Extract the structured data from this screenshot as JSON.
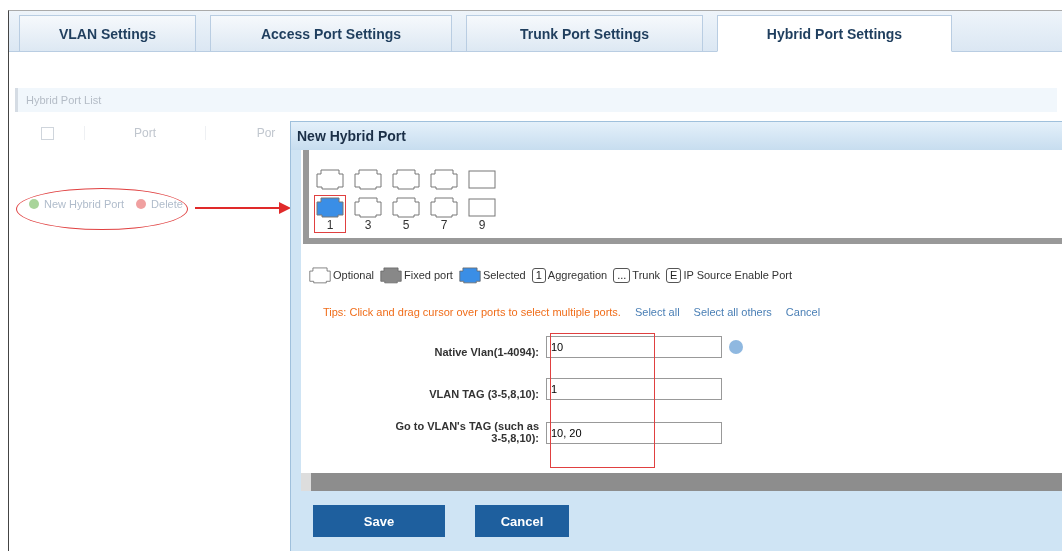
{
  "tabs": [
    {
      "label": "VLAN Settings",
      "selected": false
    },
    {
      "label": "Access Port Settings",
      "selected": false
    },
    {
      "label": "Trunk Port Settings",
      "selected": false
    },
    {
      "label": "Hybrid Port Settings",
      "selected": true
    }
  ],
  "panel": {
    "title": "Hybrid Port List",
    "columns": [
      "Port",
      "Por"
    ],
    "select_all": {
      "checked": false
    },
    "actions": [
      {
        "kind": "add",
        "label": "New Hybrid Port"
      },
      {
        "kind": "delete",
        "label": "Delete"
      }
    ]
  },
  "dialog": {
    "title": "New Hybrid Port",
    "port_rows": [
      [
        {
          "kind": "copper",
          "selected": false
        },
        {
          "kind": "copper",
          "selected": false
        },
        {
          "kind": "copper",
          "selected": false
        },
        {
          "kind": "copper",
          "selected": false
        },
        {
          "kind": "fiber",
          "selected": false
        }
      ],
      [
        {
          "kind": "copper",
          "label": "1",
          "selected": true
        },
        {
          "kind": "copper",
          "label": "3",
          "selected": false
        },
        {
          "kind": "copper",
          "label": "5",
          "selected": false
        },
        {
          "kind": "copper",
          "label": "7",
          "selected": false
        },
        {
          "kind": "fiber",
          "label": "9",
          "selected": false
        }
      ]
    ],
    "legend": [
      {
        "kind": "optional",
        "label": "Optional"
      },
      {
        "kind": "fixed",
        "label": "Fixed port"
      },
      {
        "kind": "selected",
        "label": "Selected"
      },
      {
        "kind": "boxed",
        "icon_text": "1",
        "label": "Aggregation"
      },
      {
        "kind": "trunk",
        "icon_text": "...",
        "label": "Trunk"
      },
      {
        "kind": "boxed",
        "icon_text": "E",
        "label": "IP Source Enable Port"
      }
    ],
    "tip": "Tips: Click and drag cursor over ports to select multiple ports.",
    "links": [
      "Select all",
      "Select all others",
      "Cancel"
    ],
    "fields": [
      {
        "label": "Native Vlan(1-4094):",
        "value": "10",
        "info": true
      },
      {
        "label": "VLAN TAG (3-5,8,10):",
        "value": "1",
        "info": false
      },
      {
        "label": "Go to VLAN's TAG (such as 3-5,8,10):",
        "value": "10, 20",
        "info": false
      }
    ],
    "buttons": [
      "Save",
      "Cancel"
    ]
  }
}
